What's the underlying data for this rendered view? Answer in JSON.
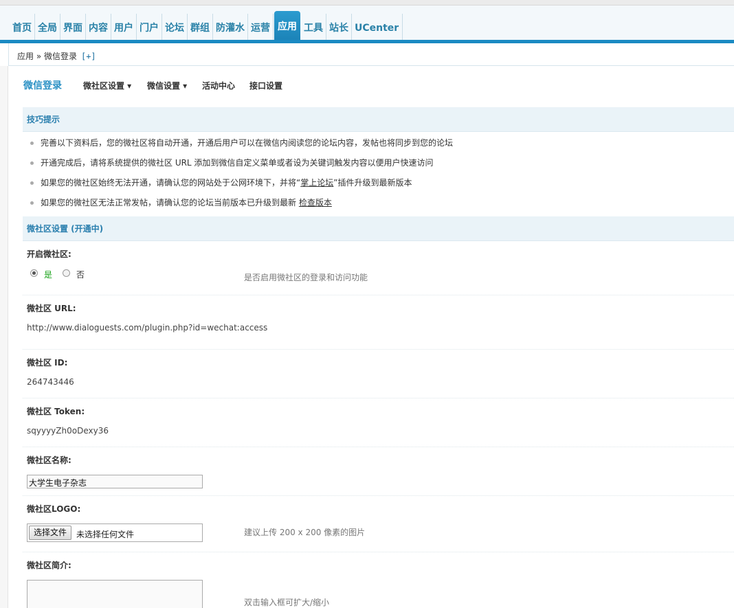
{
  "nav": {
    "items": [
      "首页",
      "全局",
      "界面",
      "内容",
      "用户",
      "门户",
      "论坛",
      "群组",
      "防灌水",
      "运营",
      "应用",
      "工具",
      "站长",
      "UCenter"
    ],
    "active_index": 10
  },
  "breadcrumb": {
    "path": "应用 » 微信登录",
    "add": "[+]"
  },
  "subnav": {
    "title": "微信登录",
    "tabs": [
      "微社区设置 ▾",
      "微信设置 ▾",
      "活动中心",
      "接口设置"
    ]
  },
  "tips": {
    "heading": "技巧提示",
    "items": [
      {
        "text": "完善以下资料后，您的微社区将自动开通，开通后用户可以在微信内阅读您的论坛内容，发帖也将同步到您的论坛"
      },
      {
        "text": "开通完成后，请将系统提供的微社区 URL 添加到微信自定义菜单或者设为关键词触发内容以便用户快速访问"
      },
      {
        "text": "如果您的微社区始终无法开通，请确认您的网站处于公网环境下，并将“",
        "link": "掌上论坛",
        "after": "”插件升级到最新版本"
      },
      {
        "text": "如果您的微社区无法正常发帖，请确认您的论坛当前版本已升级到最新",
        "link": "检查版本"
      }
    ]
  },
  "settings": {
    "heading": "微社区设置 (开通中)",
    "enable": {
      "label": "开启微社区:",
      "yes": "是",
      "no": "否",
      "selected": "是",
      "hint": "是否启用微社区的登录和访问功能"
    },
    "url": {
      "label": "微社区 URL:",
      "value": "http://www.dialoguests.com/plugin.php?id=wechat:access"
    },
    "id": {
      "label": "微社区 ID:",
      "value": "264743446"
    },
    "token": {
      "label": "微社区 Token:",
      "value": "sqyyyyZh0oDexy36"
    },
    "name": {
      "label": "微社区名称:",
      "value": "大学生电子杂志"
    },
    "logo": {
      "label": "微社区LOGO:",
      "button": "选择文件",
      "status": "未选择任何文件",
      "hint": "建议上传 200 x 200 像素的图片"
    },
    "intro": {
      "label": "微社区简介:",
      "hint": "双击输入框可扩大/缩小"
    }
  },
  "colors": {
    "accent": "#1a8ac3",
    "link": "#2a82a8",
    "radio_yes": "#19a319"
  }
}
